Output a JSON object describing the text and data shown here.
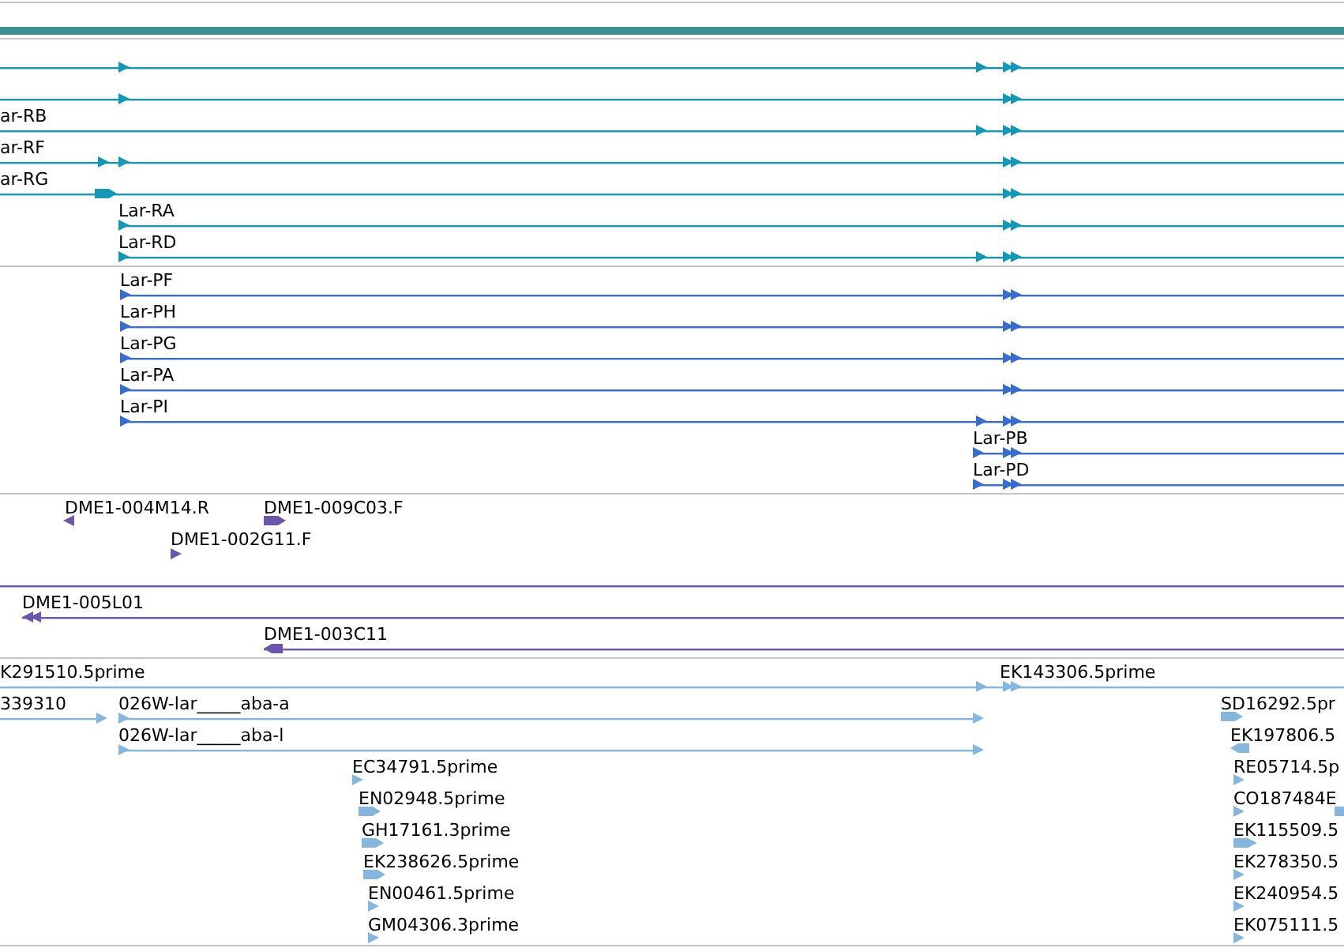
{
  "tracks": [
    {
      "color": "#1597b5",
      "features": [
        {
          "reverse": false
        },
        {
          "reverse": false
        },
        {
          "label": "ar-RB",
          "reverse": false
        },
        {
          "label": "ar-RF",
          "reverse": false
        },
        {
          "label": "ar-RG",
          "reverse": false
        },
        {
          "label": "Lar-RA",
          "reverse": false
        },
        {
          "label": "Lar-RD",
          "reverse": false
        }
      ]
    },
    {
      "color": "#3a6ccc",
      "features": [
        {
          "label": "Lar-PF",
          "reverse": false
        },
        {
          "label": "Lar-PH",
          "reverse": false
        },
        {
          "label": "Lar-PG",
          "reverse": false
        },
        {
          "label": "Lar-PA",
          "reverse": false
        },
        {
          "label": "Lar-PI",
          "reverse": false
        },
        {
          "label": "Lar-PB",
          "reverse": false
        },
        {
          "label": "Lar-PD",
          "reverse": false
        }
      ]
    },
    {
      "color": "#6c55aa",
      "features": [
        {
          "label": "DME1-004M14.R",
          "reverse": true
        },
        {
          "label": "DME1-009C03.F",
          "reverse": false
        },
        {
          "label": "DME1-002G11.F",
          "reverse": false
        },
        {
          "label": "DME1-005L01",
          "reverse": true
        },
        {
          "label": "DME1-003C11",
          "reverse": true
        }
      ]
    },
    {
      "color": "#84b6de",
      "features": [
        {
          "label": "K291510.5prime",
          "reverse": false
        },
        {
          "label": "EK143306.5prime",
          "reverse": false
        },
        {
          "label": "339310",
          "reverse": false
        },
        {
          "label": "026W-lar_____aba-a",
          "reverse": false
        },
        {
          "label": "026W-lar_____aba-l",
          "reverse": false
        },
        {
          "label": "EC34791.5prime",
          "reverse": false
        },
        {
          "label": "EN02948.5prime",
          "reverse": false
        },
        {
          "label": "GH17161.3prime",
          "reverse": false
        },
        {
          "label": "EK238626.5prime",
          "reverse": false
        },
        {
          "label": "EN00461.5prime",
          "reverse": false
        },
        {
          "label": "GM04306.3prime",
          "reverse": false
        },
        {
          "label": "SD16292.5pr",
          "reverse": false
        },
        {
          "label": "EK197806.5",
          "reverse": true
        },
        {
          "label": "RE05714.5p",
          "reverse": false
        },
        {
          "label": "CO187484E",
          "reverse": false
        },
        {
          "label": "EK115509.5",
          "reverse": false
        },
        {
          "label": "EK278350.5",
          "reverse": false
        },
        {
          "label": "EK240954.5",
          "reverse": false
        },
        {
          "label": "EK075111.5",
          "reverse": false
        }
      ]
    }
  ]
}
